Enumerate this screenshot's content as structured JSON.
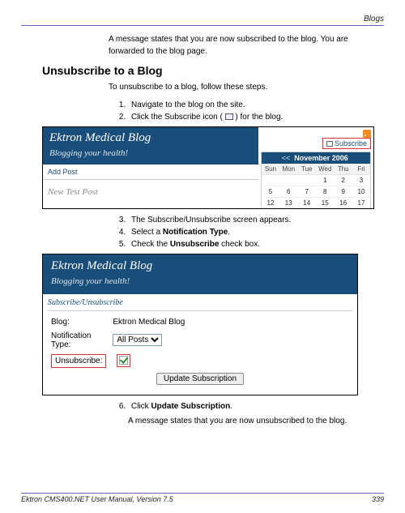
{
  "header_label": "Blogs",
  "intro": "A message states that you are now subscribed to the blog. You are forwarded to the blog page.",
  "section_heading": "Unsubscribe to a Blog",
  "section_intro": "To unsubscribe to a blog, follow these steps.",
  "steps_a": [
    "Navigate to the blog on the site.",
    "Click the Subscribe icon ( ☐ ) for the blog."
  ],
  "steps_b": [
    "The Subscribe/Unsubscribe screen appears.",
    "Select a ",
    "Check the "
  ],
  "bold_b4": "Notification Type",
  "bold_b5": "Unsubscribe",
  "tail_b5": " check box.",
  "step6_pre": "Click ",
  "step6_bold": "Update Subscription",
  "outro": "A message states that you are now unsubscribed to the blog.",
  "shot1": {
    "title": "Ektron Medical Blog",
    "subtitle": "Blogging your health!",
    "add_post": "Add Post",
    "new_test": "New Test Post",
    "subscribe_label": "Subscribe",
    "cal": {
      "prev": "<<",
      "month": "November 2006",
      "next": ">>",
      "dow": [
        "Sun",
        "Mon",
        "Tue",
        "Wed",
        "Thu",
        "Fri"
      ],
      "rows": [
        [
          "",
          "",
          "",
          "1",
          "2",
          "3"
        ],
        [
          "5",
          "6",
          "7",
          "8",
          "9",
          "10"
        ],
        [
          "12",
          "13",
          "14",
          "15",
          "16",
          "17"
        ]
      ]
    }
  },
  "shot2": {
    "title": "Ektron Medical Blog",
    "subtitle": "Blogging your health!",
    "form_title": "Subscribe/Unsubscribe",
    "blog_label": "Blog:",
    "blog_value": "Ektron Medical Blog",
    "notif_label": "Notification Type:",
    "notif_value": "All Posts",
    "unsub_label": "Unsubscribe:",
    "update_btn": "Update Subscription"
  },
  "footer_left": "Ektron CMS400.NET User Manual, Version 7.5",
  "footer_right": "339"
}
